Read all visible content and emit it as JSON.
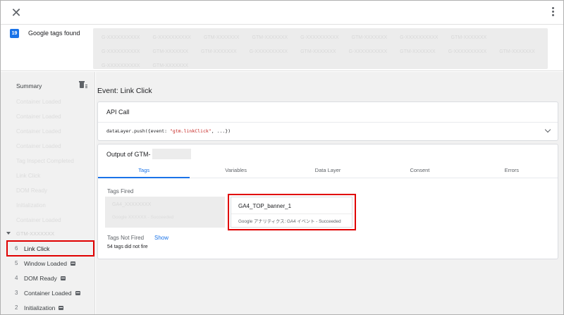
{
  "header": {
    "close_icon": "close-icon",
    "menu_icon": "more-vert-icon"
  },
  "tags_found": {
    "count": "19",
    "label": "Google tags found",
    "chips": [
      "G-XXXXXXXXXX",
      "G-XXXXXXXXXX",
      "GTM-XXXXXXX",
      "GTM-XXXXXXX",
      "G-XXXXXXXXXX",
      "GTM-XXXXXXX",
      "G-XXXXXXXXXX",
      "GTM-XXXXXXX",
      "G-XXXXXXXXXX",
      "GTM-XXXXXXX",
      "GTM-XXXXXXX",
      "G-XXXXXXXXXX",
      "GTM-XXXXXXX",
      "G-XXXXXXXXXX",
      "GTM-XXXXXXX",
      "G-XXXXXXXXXX",
      "GTM-XXXXXXX",
      "G-XXXXXXXXXX",
      "GTM-XXXXXXX"
    ]
  },
  "sidebar": {
    "summary_label": "Summary",
    "blurred_items": [
      "Container Loaded",
      "Container Loaded",
      "Container Loaded",
      "Container Loaded",
      "Tag Inspect Completed",
      "Link Click",
      "DOM Ready",
      "Initialization",
      "Container Loaded"
    ],
    "blurred_expand_label": "GTM-XXXXXXX",
    "events": [
      {
        "num": "6",
        "label": "Link Click",
        "has_icon": false,
        "selected": true
      },
      {
        "num": "5",
        "label": "Window Loaded",
        "has_icon": true,
        "selected": false
      },
      {
        "num": "4",
        "label": "DOM Ready",
        "has_icon": true,
        "selected": false
      },
      {
        "num": "3",
        "label": "Container Loaded",
        "has_icon": true,
        "selected": false
      },
      {
        "num": "2",
        "label": "Initialization",
        "has_icon": true,
        "selected": false
      }
    ]
  },
  "main": {
    "event_title": "Event: Link Click",
    "api_call": {
      "title": "API Call",
      "code_prefix": "dataLayer.push({event: ",
      "code_string": "\"gtm.linkClick\"",
      "code_suffix": ", ...})"
    },
    "output": {
      "title": "Output of GTM-",
      "tabs": [
        "Tags",
        "Variables",
        "Data Layer",
        "Consent",
        "Errors"
      ],
      "active_tab": 0,
      "tags_fired_label": "Tags Fired",
      "blurred_tag_name": "GA4_XXXXXXXX",
      "blurred_tag_status": "Google XXXXXX - Succeeded",
      "tag_card": {
        "name": "GA4_TOP_banner_1",
        "status": "Google アナリティクス: GA4 イベント - Succeeded"
      },
      "tags_not_fired_label": "Tags Not Fired",
      "show_label": "Show",
      "did_not_fire_text": "54 tags did not fire"
    }
  },
  "colors": {
    "accent": "#1a73e8",
    "highlight": "#e00000",
    "sidebar_bg": "#f1f1f1"
  }
}
